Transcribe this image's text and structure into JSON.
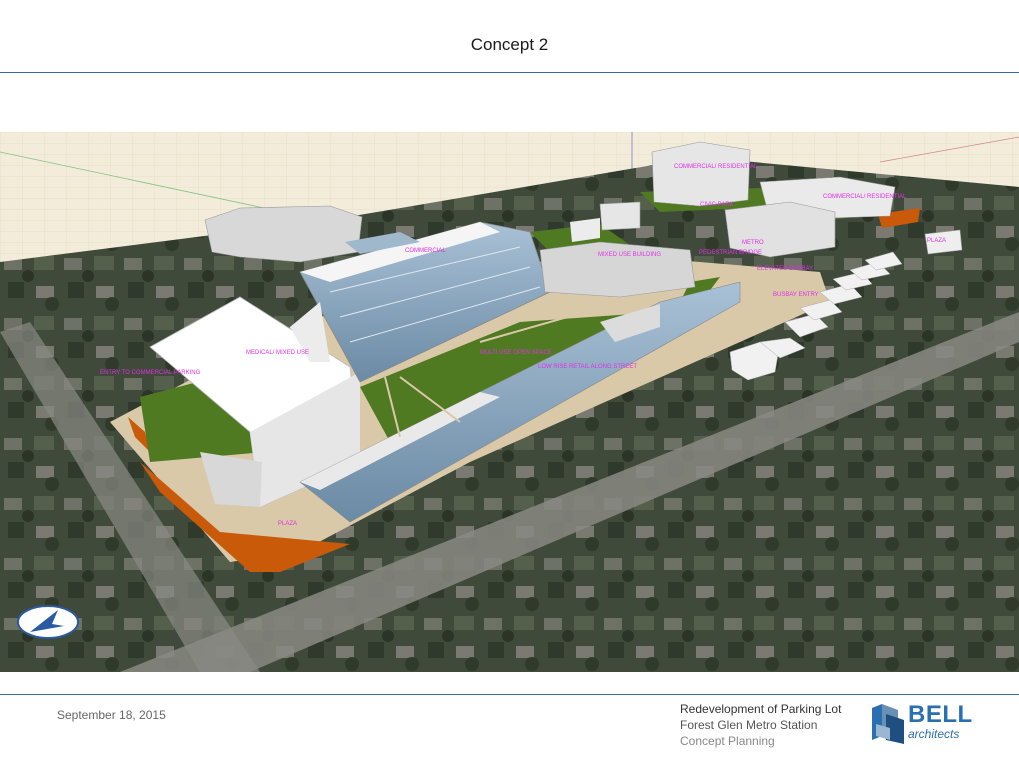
{
  "slide": {
    "title": "Concept 2"
  },
  "labels": {
    "commercial_residential": "COMMERCIAL/ RESIDENTIAL",
    "commercial_residential_2": "COMMERCIAL/ RESIDENTIAL",
    "civic_park": "CIVIC PARK",
    "commercial": "COMMERCIAL",
    "mixed_use_building": "MIXED USE BUILDING",
    "pedestrian_bridge": "PEDESTRIAN BRIDGE",
    "metro": "METRO",
    "elevated_busbay": "ELEVATED BUSBAY",
    "busbay_entry": "BUSBAY ENTRY",
    "medical_mixed_use": "MEDICAL/ MIXED USE",
    "multi_use_open_space": "MULTI USE OPEN SPACE",
    "low_rise_retail": "LOW RISE RETAIL ALONG STREET",
    "entry_commercial_parking": "ENTRY TO COMMERCIAL PARKING",
    "plaza": "PLAZA",
    "pedestrian_plaza": "PLAZA"
  },
  "footer": {
    "date": "September 18, 2015",
    "project_line1": "Redevelopment  of Parking Lot",
    "project_line2": "Forest Glen Metro Station",
    "project_line3": "Concept Planning",
    "logo_name": "BELL",
    "logo_sub": "architects"
  },
  "icons": {
    "compass": "compass-north-icon",
    "logo_mark": "bell-logo-mark-icon"
  },
  "colors": {
    "rule": "#3a6f8f",
    "label_magenta": "#e030e8",
    "plaza_orange": "#c85a0a",
    "green_roof": "#4f7a22",
    "glass": "#7f9fb8"
  }
}
